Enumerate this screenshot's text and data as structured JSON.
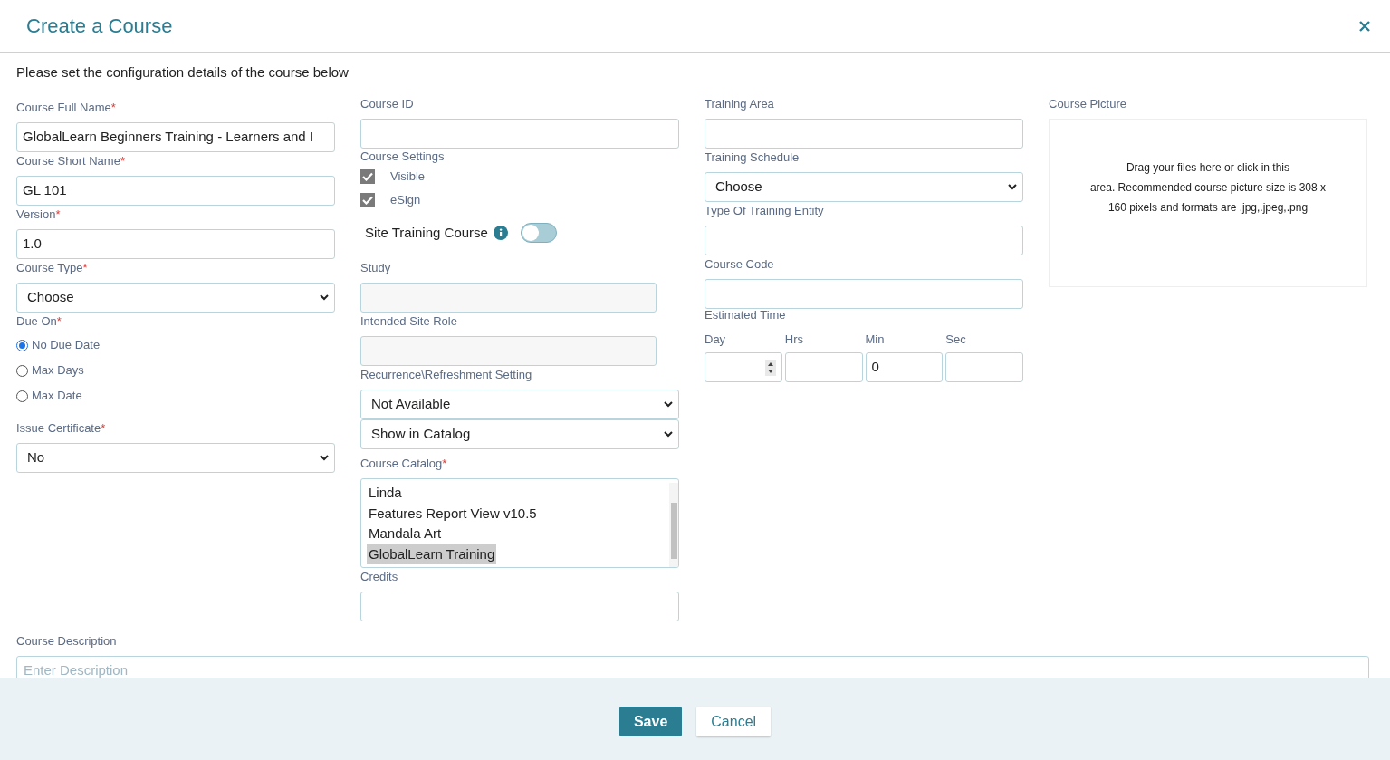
{
  "dialog": {
    "title": "Create a Course"
  },
  "intro": "Please set the configuration details of the course below",
  "columns": [
    [
      {
        "kind": "text",
        "label": "Course Full Name",
        "required_mark": "*",
        "value": "GlobalLearn Beginners Training - Learners and I"
      },
      {
        "kind": "text",
        "label": "Course Short Name",
        "required_mark": "*",
        "value": "GL 101"
      },
      {
        "kind": "text",
        "label": "Version",
        "required_mark": "*",
        "value": "1.0"
      },
      {
        "kind": "select",
        "label": "Course Type",
        "required_mark": "*",
        "value": "Choose"
      },
      {
        "kind": "radios",
        "label": "Due On",
        "required_mark": "*",
        "options": [
          {
            "label": "No Due Date",
            "selected": true
          },
          {
            "label": "Max Days",
            "selected": false
          },
          {
            "label": "Max Date",
            "selected": false
          }
        ]
      },
      {
        "kind": "select",
        "label": "Issue Certificate",
        "required_mark": "*",
        "value": "No"
      }
    ],
    [
      {
        "kind": "text",
        "label": "Course ID"
      },
      {
        "kind": "checkboxes",
        "label": "Course Settings",
        "options": [
          {
            "label": "Visible",
            "checked": true
          },
          {
            "label": "eSign",
            "checked": true
          }
        ]
      },
      {
        "kind": "toggle",
        "label": "Site Training Course",
        "on": false
      },
      {
        "kind": "text",
        "label": "Study",
        "disabled": true
      },
      {
        "kind": "text",
        "label": "Intended Site Role",
        "disabled": true
      },
      {
        "kind": "select",
        "label": "Recurrence\\Refreshment Setting",
        "value": "Not Available"
      },
      {
        "kind": "select",
        "value": "Show in Catalog"
      },
      {
        "kind": "listbox",
        "label": "Course Catalog",
        "required_mark": "*",
        "items": [
          {
            "label": "Linda",
            "selected": false
          },
          {
            "label": "Features Report View v10.5",
            "selected": false
          },
          {
            "label": "Mandala Art",
            "selected": false
          },
          {
            "label": "GlobalLearn Training",
            "selected": true
          }
        ]
      },
      {
        "kind": "text",
        "label": "Credits"
      }
    ],
    [
      {
        "kind": "text",
        "label": "Training Area"
      },
      {
        "kind": "select",
        "label": "Training Schedule",
        "value": "Choose"
      },
      {
        "kind": "text",
        "label": "Type Of Training Entity"
      },
      {
        "kind": "text",
        "label": "Course Code"
      },
      {
        "kind": "time",
        "label": "Estimated Time",
        "parts": [
          {
            "label": "Day",
            "spinner": true
          },
          {
            "label": "Hrs",
            "spinner": false
          },
          {
            "label": "Min",
            "value": "0",
            "spinner": false
          },
          {
            "label": "Sec",
            "spinner": false
          }
        ]
      }
    ],
    [
      {
        "kind": "dropzone",
        "label": "Course Picture",
        "lines": [
          "Drag your files here or click in this",
          "area. Recommended course picture size is 308 x",
          "160 pixels and formats are .jpg,.jpeg,.png"
        ]
      }
    ]
  ],
  "description": {
    "label": "Course Description",
    "placeholder": "Enter Description"
  },
  "buttons": [
    {
      "label": "Save",
      "kind": "primary"
    },
    {
      "label": "Cancel",
      "kind": "secondary"
    }
  ]
}
